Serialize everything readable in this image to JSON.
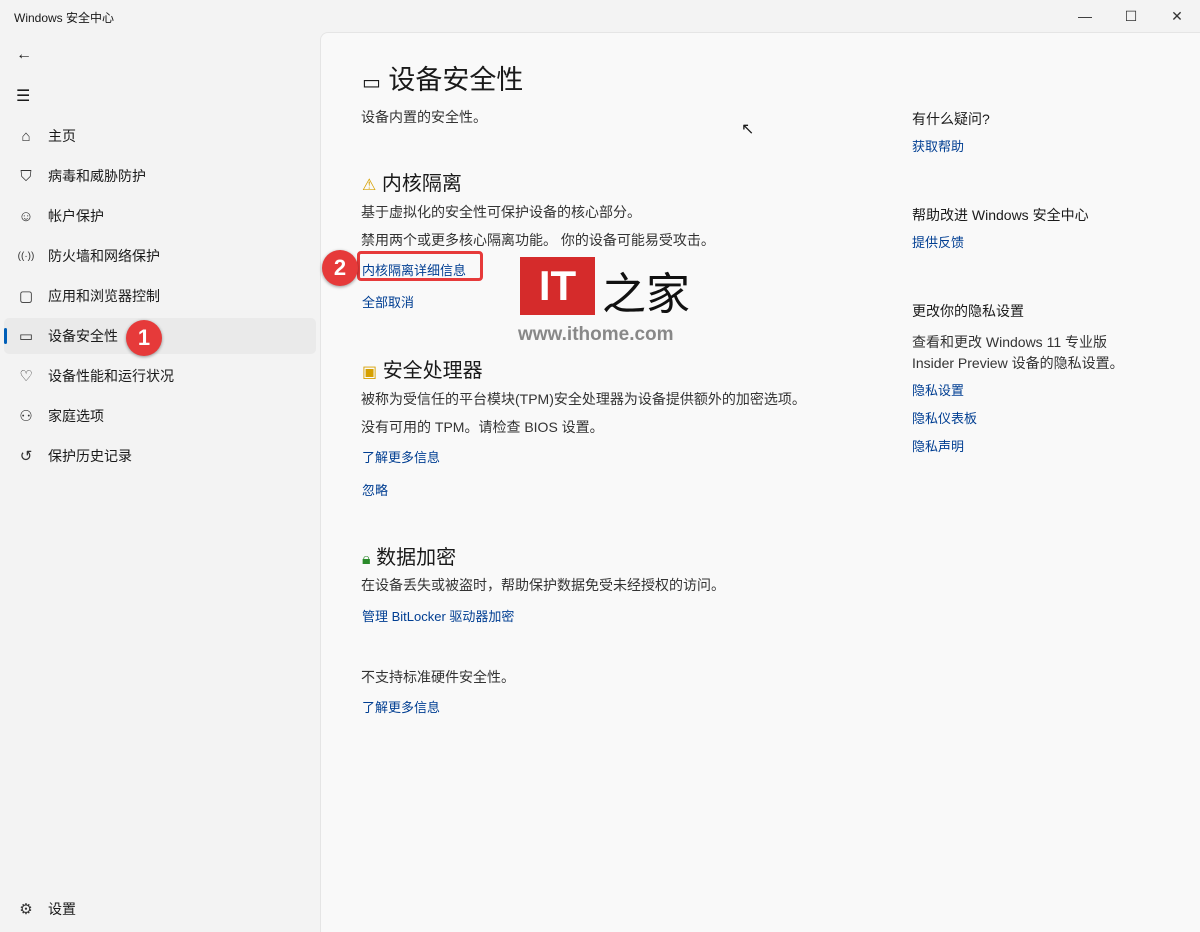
{
  "window": {
    "title": "Windows 安全中心"
  },
  "sidebar": {
    "items": [
      {
        "label": "主页",
        "icon": "home-icon"
      },
      {
        "label": "病毒和威胁防护",
        "icon": "shield-icon"
      },
      {
        "label": "帐户保护",
        "icon": "person-icon"
      },
      {
        "label": "防火墙和网络保护",
        "icon": "wifi-icon"
      },
      {
        "label": "应用和浏览器控制",
        "icon": "window-icon"
      },
      {
        "label": "设备安全性",
        "icon": "laptop-icon",
        "active": true
      },
      {
        "label": "设备性能和运行状况",
        "icon": "heart-icon"
      },
      {
        "label": "家庭选项",
        "icon": "family-icon"
      },
      {
        "label": "保护历史记录",
        "icon": "history-icon"
      }
    ],
    "settings": "设置"
  },
  "main": {
    "title": "设备安全性",
    "subtitle": "设备内置的安全性。",
    "core": {
      "heading": "内核隔离",
      "desc1": "基于虚拟化的安全性可保护设备的核心部分。",
      "desc2": "禁用两个或更多核心隔离功能。 你的设备可能易受攻击。",
      "link1": "内核隔离详细信息",
      "link2": "全部取消"
    },
    "tpm": {
      "heading": "安全处理器",
      "desc1": "被称为受信任的平台模块(TPM)安全处理器为设备提供额外的加密选项。",
      "desc2": "没有可用的 TPM。请检查 BIOS 设置。",
      "link1": "了解更多信息",
      "link2": "忽略"
    },
    "enc": {
      "heading": "数据加密",
      "desc": "在设备丢失或被盗时，帮助保护数据免受未经授权的访问。",
      "link": "管理 BitLocker 驱动器加密"
    },
    "hw": {
      "desc": "不支持标准硬件安全性。",
      "link": "了解更多信息"
    }
  },
  "right": {
    "q": "有什么疑问?",
    "help": "获取帮助",
    "improve": "帮助改进 Windows 安全中心",
    "feedback": "提供反馈",
    "privacy": "更改你的隐私设置",
    "pdesc1": "查看和更改 Windows 11 专业版",
    "pdesc2": "Insider Preview 设备的隐私设置。",
    "p1": "隐私设置",
    "p2": "隐私仪表板",
    "p3": "隐私声明"
  },
  "annotations": {
    "b1": "1",
    "b2": "2"
  },
  "watermark": {
    "logo": "IT之家",
    "url": "www.ithome.com"
  }
}
